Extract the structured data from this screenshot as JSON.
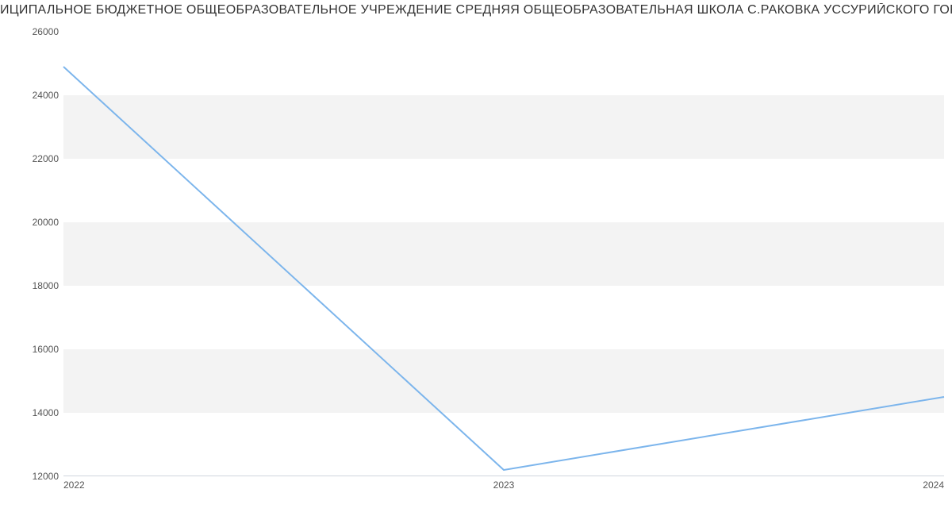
{
  "title": "ИЦИПАЛЬНОЕ БЮДЖЕТНОЕ ОБЩЕОБРАЗОВАТЕЛЬНОЕ УЧРЕЖДЕНИЕ СРЕДНЯЯ ОБЩЕОБРАЗОВАТЕЛЬНАЯ ШКОЛА С.РАКОВКА УССУРИЙСКОГО ГОРОДСКОГО ОКРУГА | Дан",
  "chart_data": {
    "type": "line",
    "x": [
      2022,
      2023,
      2024
    ],
    "values": [
      24900,
      12200,
      14500
    ],
    "title": "ИЦИПАЛЬНОЕ БЮДЖЕТНОЕ ОБЩЕОБРАЗОВАТЕЛЬНОЕ УЧРЕЖДЕНИЕ СРЕДНЯЯ ОБЩЕОБРАЗОВАТЕЛЬНАЯ ШКОЛА С.РАКОВКА УССУРИЙСКОГО ГОРОДСКОГО ОКРУГА | Дан",
    "xlabel": "",
    "ylabel": "",
    "xlim": [
      2022,
      2024
    ],
    "ylim": [
      12000,
      26000
    ],
    "line_color": "#7cb5ec",
    "y_ticks": [
      12000,
      14000,
      16000,
      18000,
      20000,
      22000,
      24000,
      26000
    ],
    "x_ticks": [
      2022,
      2023,
      2024
    ]
  }
}
